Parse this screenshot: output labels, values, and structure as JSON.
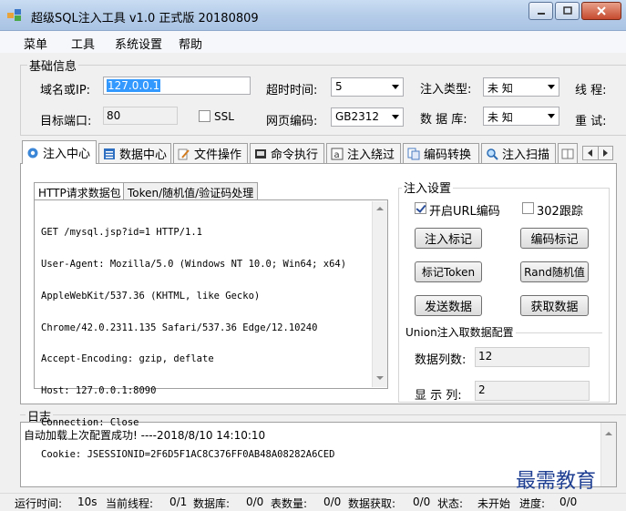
{
  "window": {
    "title": "超级SQL注入工具 v1.0 正式版 20180809"
  },
  "menu": [
    {
      "label": "菜单"
    },
    {
      "label": "工具"
    },
    {
      "label": "系统设置"
    },
    {
      "label": "帮助"
    }
  ],
  "basic_info": {
    "group_label": "基础信息",
    "domain_label": "域名或IP:",
    "domain_value": "127.0.0.1",
    "port_label": "目标端口:",
    "port_value": "80",
    "ssl_label": "SSL",
    "timeout_label": "超时时间:",
    "timeout_value": "5",
    "encoding_label": "网页编码:",
    "encoding_value": "GB2312",
    "inject_type_label": "注入类型:",
    "inject_type_value": "未 知",
    "database_label": "数 据 库:",
    "database_value": "未 知",
    "threads_label": "线 程:",
    "retry_label": "重 试:"
  },
  "tabs": [
    {
      "label": "注入中心",
      "icon": "gear-icon"
    },
    {
      "label": "数据中心",
      "icon": "database-icon"
    },
    {
      "label": "文件操作",
      "icon": "file-edit-icon"
    },
    {
      "label": "命令执行",
      "icon": "terminal-icon"
    },
    {
      "label": "注入绕过",
      "icon": "bypass-icon"
    },
    {
      "label": "编码转换",
      "icon": "encode-icon"
    },
    {
      "label": "注入扫描",
      "icon": "scan-icon"
    }
  ],
  "injection_center": {
    "subtabs": [
      {
        "label": "HTTP请求数据包"
      },
      {
        "label": "Token/随机值/验证码处理"
      }
    ],
    "request_lines": [
      "GET /mysql.jsp?id=1 HTTP/1.1",
      "User-Agent: Mozilla/5.0 (Windows NT 10.0; Win64; x64)",
      "AppleWebKit/537.36 (KHTML, like Gecko)",
      "Chrome/42.0.2311.135 Safari/537.36 Edge/12.10240",
      "Accept-Encoding: gzip, deflate",
      "Host: 127.0.0.1:8090",
      "Connection: Close",
      "Cookie: JSESSIONID=2F6D5F1AC8C376FF0AB48A08282A6CED"
    ],
    "settings_label": "注入设置",
    "url_encode_label": "开启URL编码",
    "follow302_label": "302跟踪",
    "btn_mark": "注入标记",
    "btn_encode_mark": "编码标记",
    "btn_token": "标记Token",
    "btn_rand": "Rand随机值",
    "btn_send": "发送数据",
    "btn_fetch": "获取数据",
    "union_label": "Union注入取数据配置",
    "columns_label": "数据列数:",
    "columns_value": "12",
    "display_label": "显 示 列:",
    "display_value": "2"
  },
  "log": {
    "label": "日志",
    "entry": "自动加载上次配置成功! ----2018/8/10 14:10:10"
  },
  "watermark": "最需教育",
  "status": {
    "run_time_label": "运行时间:",
    "run_time": "10s",
    "current_thread_label": "当前线程:",
    "current_thread": "0/1",
    "database_label": "数据库:",
    "database": "0/0",
    "tables_label": "表数量:",
    "tables": "0/0",
    "fetch_label": "数据获取:",
    "fetch": "0/0",
    "state_label": "状态:",
    "state": "未开始",
    "progress_label": "进度:",
    "progress": "0/0"
  }
}
